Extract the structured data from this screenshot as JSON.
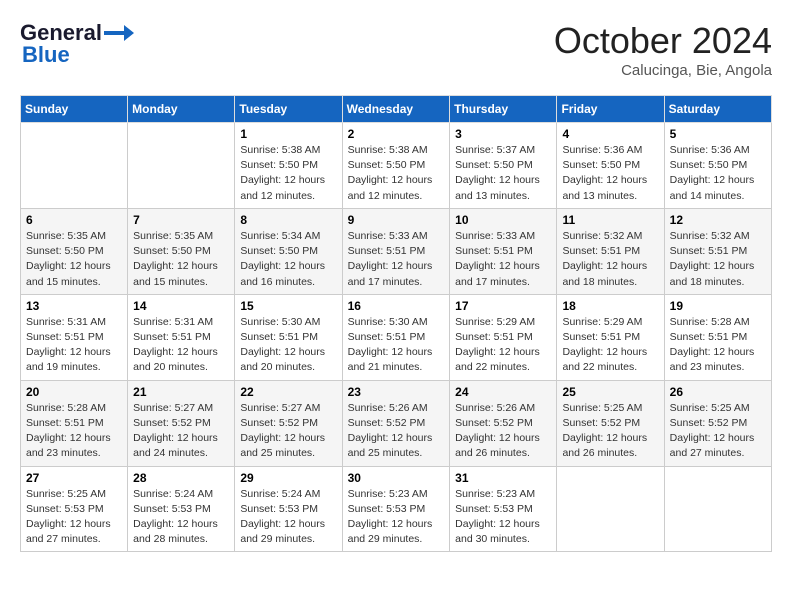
{
  "logo": {
    "general": "General",
    "blue": "Blue"
  },
  "header": {
    "month": "October 2024",
    "location": "Calucinga, Bie, Angola"
  },
  "weekdays": [
    "Sunday",
    "Monday",
    "Tuesday",
    "Wednesday",
    "Thursday",
    "Friday",
    "Saturday"
  ],
  "weeks": [
    [
      {
        "day": "",
        "sunrise": "",
        "sunset": "",
        "daylight": ""
      },
      {
        "day": "",
        "sunrise": "",
        "sunset": "",
        "daylight": ""
      },
      {
        "day": "1",
        "sunrise": "Sunrise: 5:38 AM",
        "sunset": "Sunset: 5:50 PM",
        "daylight": "Daylight: 12 hours and 12 minutes."
      },
      {
        "day": "2",
        "sunrise": "Sunrise: 5:38 AM",
        "sunset": "Sunset: 5:50 PM",
        "daylight": "Daylight: 12 hours and 12 minutes."
      },
      {
        "day": "3",
        "sunrise": "Sunrise: 5:37 AM",
        "sunset": "Sunset: 5:50 PM",
        "daylight": "Daylight: 12 hours and 13 minutes."
      },
      {
        "day": "4",
        "sunrise": "Sunrise: 5:36 AM",
        "sunset": "Sunset: 5:50 PM",
        "daylight": "Daylight: 12 hours and 13 minutes."
      },
      {
        "day": "5",
        "sunrise": "Sunrise: 5:36 AM",
        "sunset": "Sunset: 5:50 PM",
        "daylight": "Daylight: 12 hours and 14 minutes."
      }
    ],
    [
      {
        "day": "6",
        "sunrise": "Sunrise: 5:35 AM",
        "sunset": "Sunset: 5:50 PM",
        "daylight": "Daylight: 12 hours and 15 minutes."
      },
      {
        "day": "7",
        "sunrise": "Sunrise: 5:35 AM",
        "sunset": "Sunset: 5:50 PM",
        "daylight": "Daylight: 12 hours and 15 minutes."
      },
      {
        "day": "8",
        "sunrise": "Sunrise: 5:34 AM",
        "sunset": "Sunset: 5:50 PM",
        "daylight": "Daylight: 12 hours and 16 minutes."
      },
      {
        "day": "9",
        "sunrise": "Sunrise: 5:33 AM",
        "sunset": "Sunset: 5:51 PM",
        "daylight": "Daylight: 12 hours and 17 minutes."
      },
      {
        "day": "10",
        "sunrise": "Sunrise: 5:33 AM",
        "sunset": "Sunset: 5:51 PM",
        "daylight": "Daylight: 12 hours and 17 minutes."
      },
      {
        "day": "11",
        "sunrise": "Sunrise: 5:32 AM",
        "sunset": "Sunset: 5:51 PM",
        "daylight": "Daylight: 12 hours and 18 minutes."
      },
      {
        "day": "12",
        "sunrise": "Sunrise: 5:32 AM",
        "sunset": "Sunset: 5:51 PM",
        "daylight": "Daylight: 12 hours and 18 minutes."
      }
    ],
    [
      {
        "day": "13",
        "sunrise": "Sunrise: 5:31 AM",
        "sunset": "Sunset: 5:51 PM",
        "daylight": "Daylight: 12 hours and 19 minutes."
      },
      {
        "day": "14",
        "sunrise": "Sunrise: 5:31 AM",
        "sunset": "Sunset: 5:51 PM",
        "daylight": "Daylight: 12 hours and 20 minutes."
      },
      {
        "day": "15",
        "sunrise": "Sunrise: 5:30 AM",
        "sunset": "Sunset: 5:51 PM",
        "daylight": "Daylight: 12 hours and 20 minutes."
      },
      {
        "day": "16",
        "sunrise": "Sunrise: 5:30 AM",
        "sunset": "Sunset: 5:51 PM",
        "daylight": "Daylight: 12 hours and 21 minutes."
      },
      {
        "day": "17",
        "sunrise": "Sunrise: 5:29 AM",
        "sunset": "Sunset: 5:51 PM",
        "daylight": "Daylight: 12 hours and 22 minutes."
      },
      {
        "day": "18",
        "sunrise": "Sunrise: 5:29 AM",
        "sunset": "Sunset: 5:51 PM",
        "daylight": "Daylight: 12 hours and 22 minutes."
      },
      {
        "day": "19",
        "sunrise": "Sunrise: 5:28 AM",
        "sunset": "Sunset: 5:51 PM",
        "daylight": "Daylight: 12 hours and 23 minutes."
      }
    ],
    [
      {
        "day": "20",
        "sunrise": "Sunrise: 5:28 AM",
        "sunset": "Sunset: 5:51 PM",
        "daylight": "Daylight: 12 hours and 23 minutes."
      },
      {
        "day": "21",
        "sunrise": "Sunrise: 5:27 AM",
        "sunset": "Sunset: 5:52 PM",
        "daylight": "Daylight: 12 hours and 24 minutes."
      },
      {
        "day": "22",
        "sunrise": "Sunrise: 5:27 AM",
        "sunset": "Sunset: 5:52 PM",
        "daylight": "Daylight: 12 hours and 25 minutes."
      },
      {
        "day": "23",
        "sunrise": "Sunrise: 5:26 AM",
        "sunset": "Sunset: 5:52 PM",
        "daylight": "Daylight: 12 hours and 25 minutes."
      },
      {
        "day": "24",
        "sunrise": "Sunrise: 5:26 AM",
        "sunset": "Sunset: 5:52 PM",
        "daylight": "Daylight: 12 hours and 26 minutes."
      },
      {
        "day": "25",
        "sunrise": "Sunrise: 5:25 AM",
        "sunset": "Sunset: 5:52 PM",
        "daylight": "Daylight: 12 hours and 26 minutes."
      },
      {
        "day": "26",
        "sunrise": "Sunrise: 5:25 AM",
        "sunset": "Sunset: 5:52 PM",
        "daylight": "Daylight: 12 hours and 27 minutes."
      }
    ],
    [
      {
        "day": "27",
        "sunrise": "Sunrise: 5:25 AM",
        "sunset": "Sunset: 5:53 PM",
        "daylight": "Daylight: 12 hours and 27 minutes."
      },
      {
        "day": "28",
        "sunrise": "Sunrise: 5:24 AM",
        "sunset": "Sunset: 5:53 PM",
        "daylight": "Daylight: 12 hours and 28 minutes."
      },
      {
        "day": "29",
        "sunrise": "Sunrise: 5:24 AM",
        "sunset": "Sunset: 5:53 PM",
        "daylight": "Daylight: 12 hours and 29 minutes."
      },
      {
        "day": "30",
        "sunrise": "Sunrise: 5:23 AM",
        "sunset": "Sunset: 5:53 PM",
        "daylight": "Daylight: 12 hours and 29 minutes."
      },
      {
        "day": "31",
        "sunrise": "Sunrise: 5:23 AM",
        "sunset": "Sunset: 5:53 PM",
        "daylight": "Daylight: 12 hours and 30 minutes."
      },
      {
        "day": "",
        "sunrise": "",
        "sunset": "",
        "daylight": ""
      },
      {
        "day": "",
        "sunrise": "",
        "sunset": "",
        "daylight": ""
      }
    ]
  ]
}
